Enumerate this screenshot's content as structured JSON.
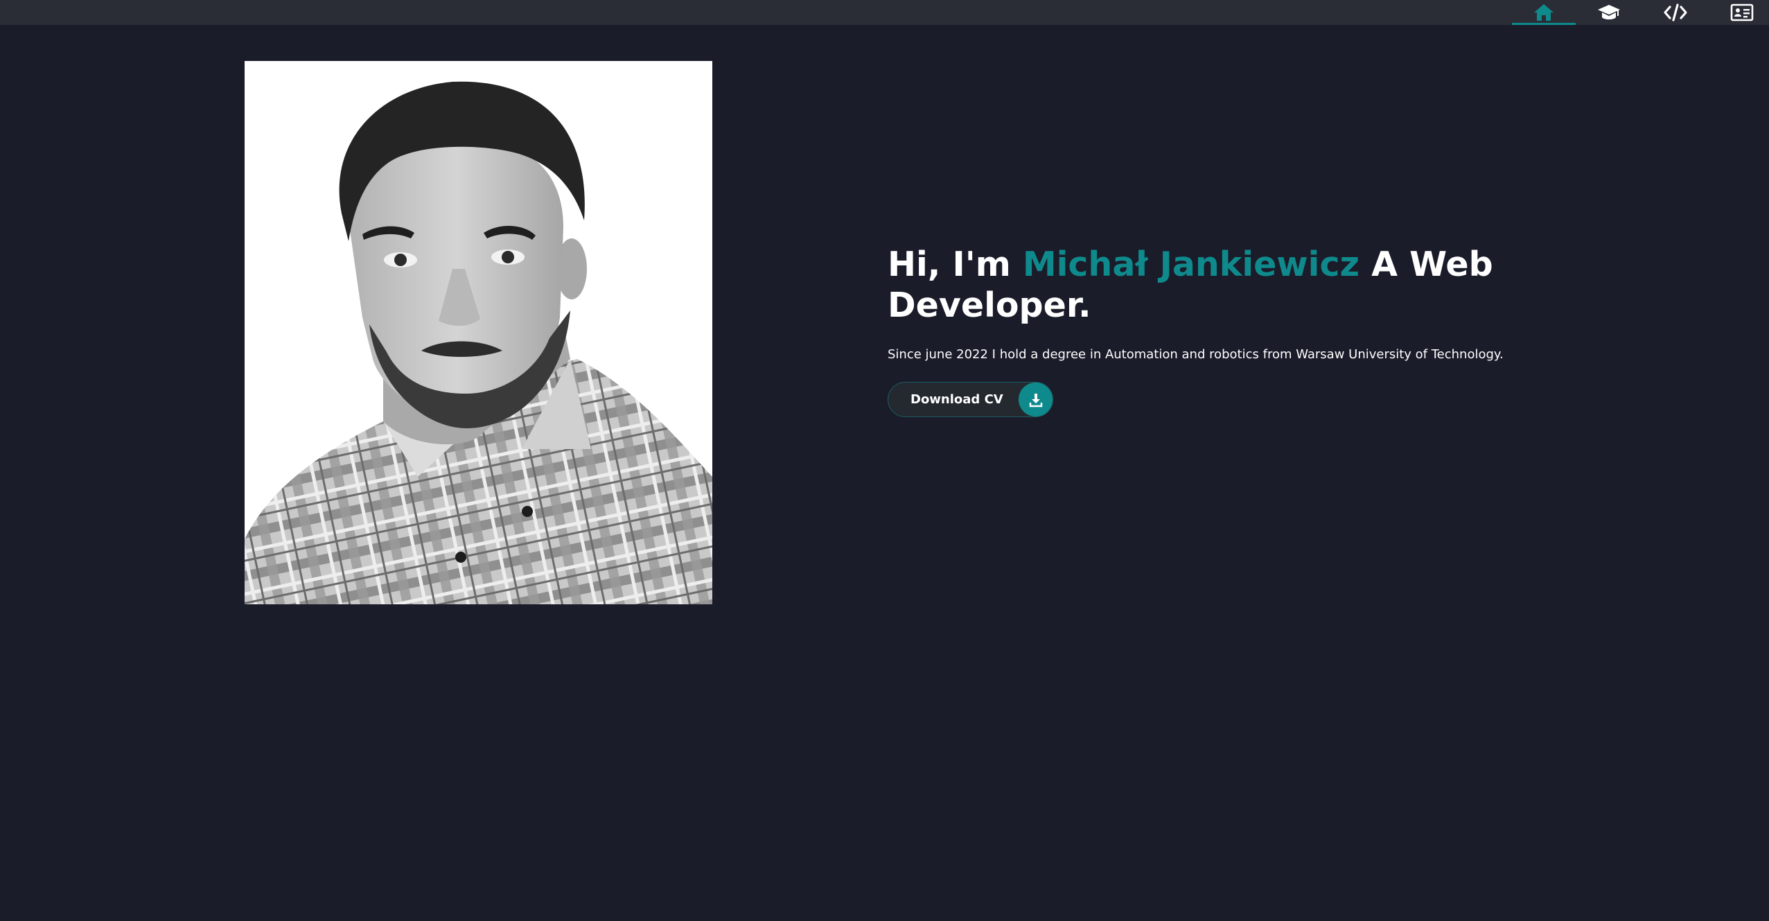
{
  "nav": {
    "items": [
      {
        "icon": "home-icon",
        "active": true
      },
      {
        "icon": "graduation-cap-icon",
        "active": false
      },
      {
        "icon": "code-icon",
        "active": false
      },
      {
        "icon": "contact-card-icon",
        "active": false
      }
    ],
    "active_color": "#0f8a8c"
  },
  "hero": {
    "greeting": "Hi, I'm ",
    "name": "Michał Jankiewicz",
    "role": " A Web Developer.",
    "description": "Since june 2022 I hold a degree in Automation and robotics from Warsaw University of Technology.",
    "cv_button_label": "Download CV",
    "cv_button_icon": "download-icon"
  },
  "colors": {
    "background": "#1a1c2a",
    "topbar": "#2a2d36",
    "accent": "#0f8a8c",
    "text": "#ffffff"
  }
}
